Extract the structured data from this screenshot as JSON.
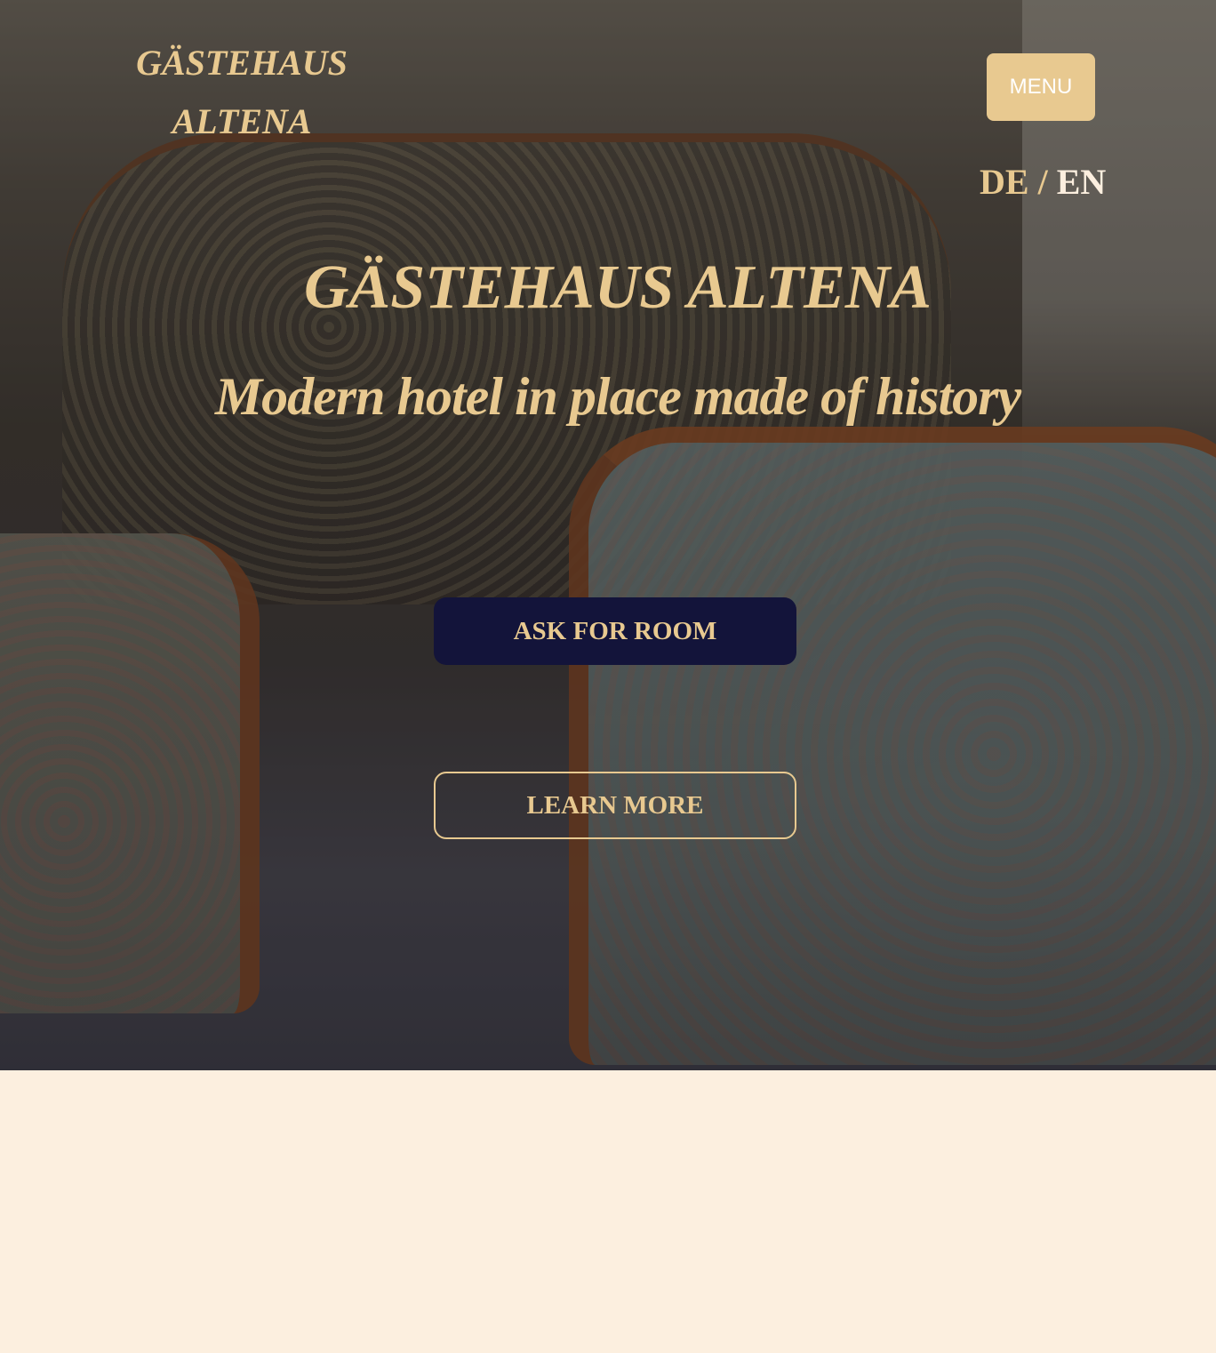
{
  "header": {
    "logo_line1": "GÄSTEHAUS",
    "logo_line2": "ALTENA",
    "menu_label": "MENU",
    "lang_de": "DE",
    "lang_separator": "/",
    "lang_en": "EN"
  },
  "hero": {
    "title": "GÄSTEHAUS ALTENA",
    "subtitle": "Modern hotel in place made of history",
    "ask_button_label": "ASK FOR ROOM",
    "learn_button_label": "LEARN MORE"
  },
  "colors": {
    "gold_accent": "#e8c990",
    "navy_button": "#13143a",
    "page_background": "#fcefdf",
    "active_language": "#fcefdf"
  }
}
